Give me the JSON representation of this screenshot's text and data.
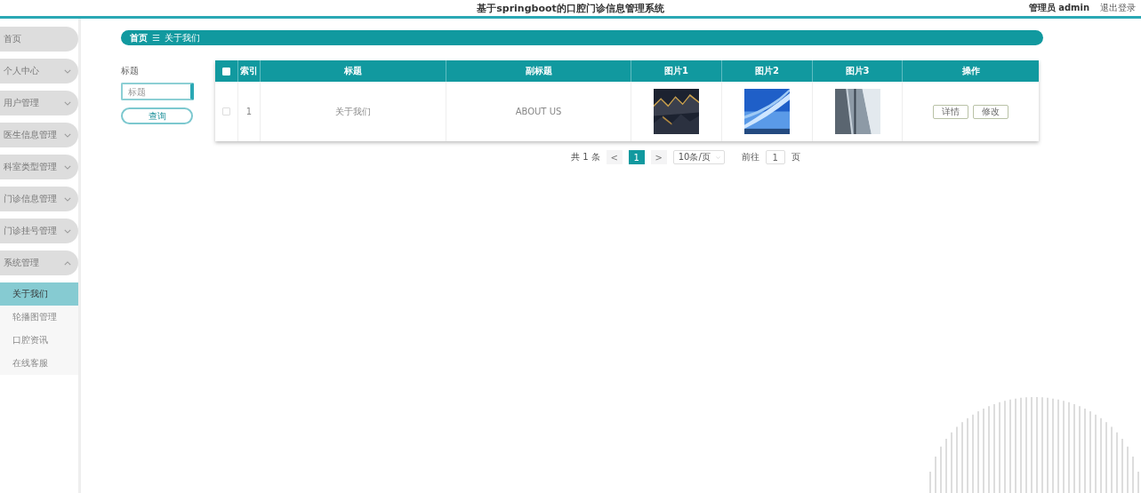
{
  "header": {
    "title": "基于springboot的口腔门诊信息管理系统",
    "user": "管理员 admin",
    "logout": "退出登录"
  },
  "sidebar": {
    "items": [
      {
        "label": "首页"
      },
      {
        "label": "个人中心",
        "expanded": false
      },
      {
        "label": "用户管理",
        "expanded": false
      },
      {
        "label": "医生信息管理",
        "expanded": false
      },
      {
        "label": "科室类型管理",
        "expanded": false
      },
      {
        "label": "门诊信息管理",
        "expanded": false
      },
      {
        "label": "门诊挂号管理",
        "expanded": false
      },
      {
        "label": "系统管理",
        "expanded": true,
        "children": [
          {
            "label": "关于我们",
            "selected": true
          },
          {
            "label": "轮播图管理",
            "selected": false
          },
          {
            "label": "口腔资讯",
            "selected": false
          },
          {
            "label": "在线客服",
            "selected": false
          }
        ]
      }
    ]
  },
  "breadcrumb": {
    "items": [
      "首页",
      "关于我们"
    ],
    "separator": "☰"
  },
  "search": {
    "label": "标题",
    "placeholder": "标题",
    "button": "查询"
  },
  "table": {
    "columns": [
      "索引",
      "标题",
      "副标题",
      "图片1",
      "图片2",
      "图片3",
      "操作"
    ],
    "all_checked": false,
    "rows": [
      {
        "checked": false,
        "index": "1",
        "title": "关于我们",
        "subtitle": "ABOUT US",
        "images": [
          {
            "kind": "picture"
          },
          {
            "kind": "picture"
          },
          {
            "kind": "picture"
          }
        ],
        "actions": [
          "详情",
          "修改"
        ]
      }
    ]
  },
  "pagination": {
    "total": "共 1 条",
    "prev": "<",
    "pages": [
      {
        "label": "1",
        "selected": true
      }
    ],
    "next": ">",
    "page_size": "10条/页",
    "goto_label": "前往",
    "goto_value": "1",
    "goto_unit": "页"
  }
}
